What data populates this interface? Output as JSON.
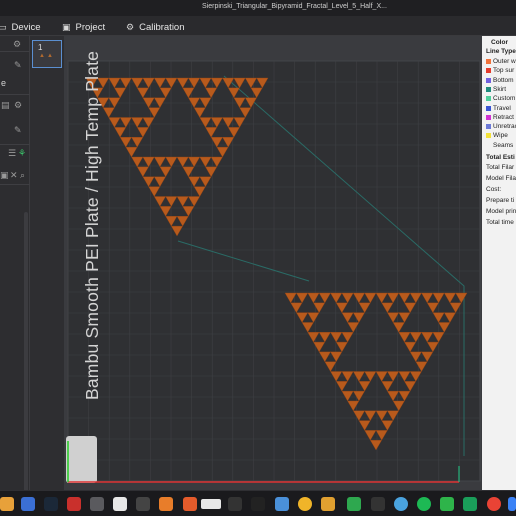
{
  "window": {
    "title": "Sierpinski_Triangular_Bipyramid_Fractal_Level_5_Half_X..."
  },
  "toolbar": {
    "tabs": [
      {
        "label": "Device",
        "icon": "device-icon"
      },
      {
        "label": "Project",
        "icon": "project-icon"
      },
      {
        "label": "Calibration",
        "icon": "calibration-icon"
      }
    ]
  },
  "left_panel": {
    "labels": {
      "e": "e"
    }
  },
  "plate_list": {
    "items": [
      {
        "number": "1"
      }
    ]
  },
  "viewport": {
    "plate_label": "Bambu Smooth PEI Plate / High Temp Plate",
    "layer_number": "01",
    "colors": {
      "model": "#b85a1c",
      "plate": "#2f3033",
      "grid": "#3f4044",
      "travel": "#2a6b66"
    }
  },
  "legend": {
    "header": "Color",
    "section": "Line Type",
    "items": [
      {
        "label": "Outer w",
        "color": "#f2733b"
      },
      {
        "label": "Top sur",
        "color": "#e53c2c"
      },
      {
        "label": "Bottom",
        "color": "#7160e0"
      },
      {
        "label": "Skirt",
        "color": "#1f8c7e"
      },
      {
        "label": "Custom",
        "color": "#4fcf9c"
      },
      {
        "label": "Travel",
        "color": "#3a55d4"
      },
      {
        "label": "Retract",
        "color": "#d233d2"
      },
      {
        "label": "Unretrac",
        "color": "#6c7ad8"
      },
      {
        "label": "Wipe",
        "color": "#f3e23a"
      },
      {
        "label": "Seams",
        "color": "#f2f2f2"
      }
    ],
    "totals": {
      "title": "Total Esti",
      "lines": [
        "Total Filar",
        "Model Fila",
        "Cost:",
        "Prepare ti",
        "Model prin",
        "Total time"
      ]
    }
  }
}
